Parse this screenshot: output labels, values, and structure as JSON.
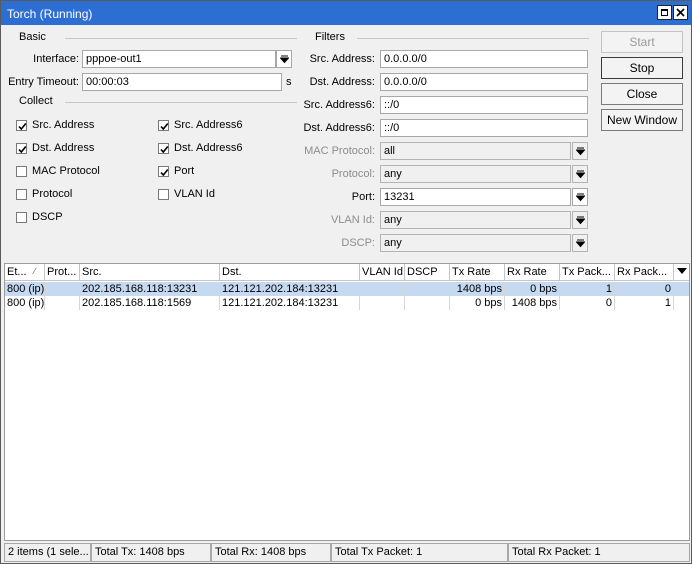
{
  "window": {
    "title": "Torch (Running)"
  },
  "basic": {
    "group_label": "Basic",
    "interface_label": "Interface:",
    "interface_value": "pppoe-out1",
    "entry_timeout_label": "Entry Timeout:",
    "entry_timeout_value": "00:00:03",
    "entry_timeout_unit": "s"
  },
  "collect": {
    "group_label": "Collect",
    "items": [
      {
        "label": "Src. Address",
        "checked": true
      },
      {
        "label": "Src. Address6",
        "checked": true
      },
      {
        "label": "Dst. Address",
        "checked": true
      },
      {
        "label": "Dst. Address6",
        "checked": true
      },
      {
        "label": "MAC Protocol",
        "checked": false
      },
      {
        "label": "Port",
        "checked": true
      },
      {
        "label": "Protocol",
        "checked": false
      },
      {
        "label": "VLAN Id",
        "checked": false
      },
      {
        "label": "DSCP",
        "checked": false
      }
    ]
  },
  "filters": {
    "group_label": "Filters",
    "fields": [
      {
        "label": "Src. Address:",
        "value": "0.0.0.0/0",
        "enabled": true
      },
      {
        "label": "Dst. Address:",
        "value": "0.0.0.0/0",
        "enabled": true
      },
      {
        "label": "Src. Address6:",
        "value": "::/0",
        "enabled": true
      },
      {
        "label": "Dst. Address6:",
        "value": "::/0",
        "enabled": true
      },
      {
        "label": "MAC Protocol:",
        "value": "all",
        "enabled": false
      },
      {
        "label": "Protocol:",
        "value": "any",
        "enabled": false
      },
      {
        "label": "Port:",
        "value": "13231",
        "enabled": true
      },
      {
        "label": "VLAN Id:",
        "value": "any",
        "enabled": false
      },
      {
        "label": "DSCP:",
        "value": "any",
        "enabled": false
      }
    ]
  },
  "buttons": {
    "start": "Start",
    "stop": "Stop",
    "close": "Close",
    "new_window": "New Window"
  },
  "table": {
    "columns": [
      "Et...",
      "Prot...",
      "Src.",
      "Dst.",
      "VLAN Id",
      "DSCP",
      "Tx Rate",
      "Rx Rate",
      "Tx Pack...",
      "Rx Pack..."
    ],
    "rows": [
      [
        "800 (ip)",
        "",
        "202.185.168.118:13231",
        "121.121.202.184:13231",
        "",
        "",
        "1408 bps",
        "0 bps",
        "1",
        "0"
      ],
      [
        "800 (ip)",
        "",
        "202.185.168.118:1569",
        "121.121.202.184:13231",
        "",
        "",
        "0 bps",
        "1408 bps",
        "0",
        "1"
      ]
    ]
  },
  "status": {
    "items": "2 items (1 sele...",
    "total_tx": "Total Tx: 1408 bps",
    "total_rx": "Total Rx: 1408 bps",
    "total_tx_packet": "Total Tx Packet: 1",
    "total_rx_packet": "Total Rx Packet: 1"
  },
  "colors": {
    "titlebar": "#2d6ed3",
    "selected_row": "#c5d9f1"
  }
}
